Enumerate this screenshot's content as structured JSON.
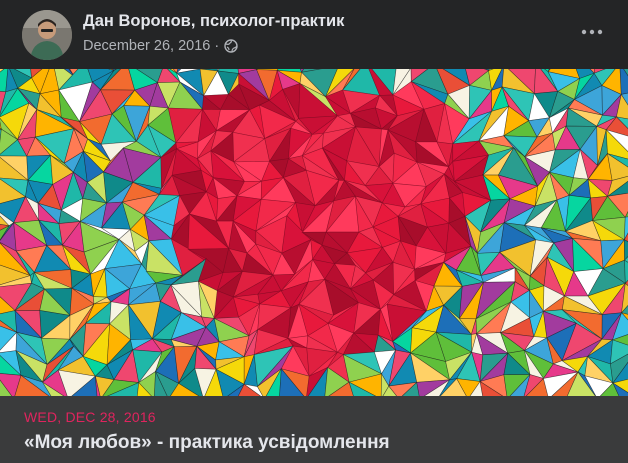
{
  "post": {
    "author": "Дан Воронов, психолог-практик",
    "date": "December 26, 2016",
    "separator": "·",
    "privacy_icon": "globe-icon",
    "more_icon": "more-options-icon"
  },
  "image": {
    "description_icon": "mosaic-heart-image"
  },
  "event": {
    "date": "WED, DEC 28, 2016",
    "title": "«Моя любов» - практика усвідомлення"
  },
  "colors": {
    "background": "#242526",
    "event_background": "#3a3b3c",
    "event_date": "#e0245e",
    "text_primary": "#e4e6eb",
    "text_secondary": "#b0b3b8"
  }
}
